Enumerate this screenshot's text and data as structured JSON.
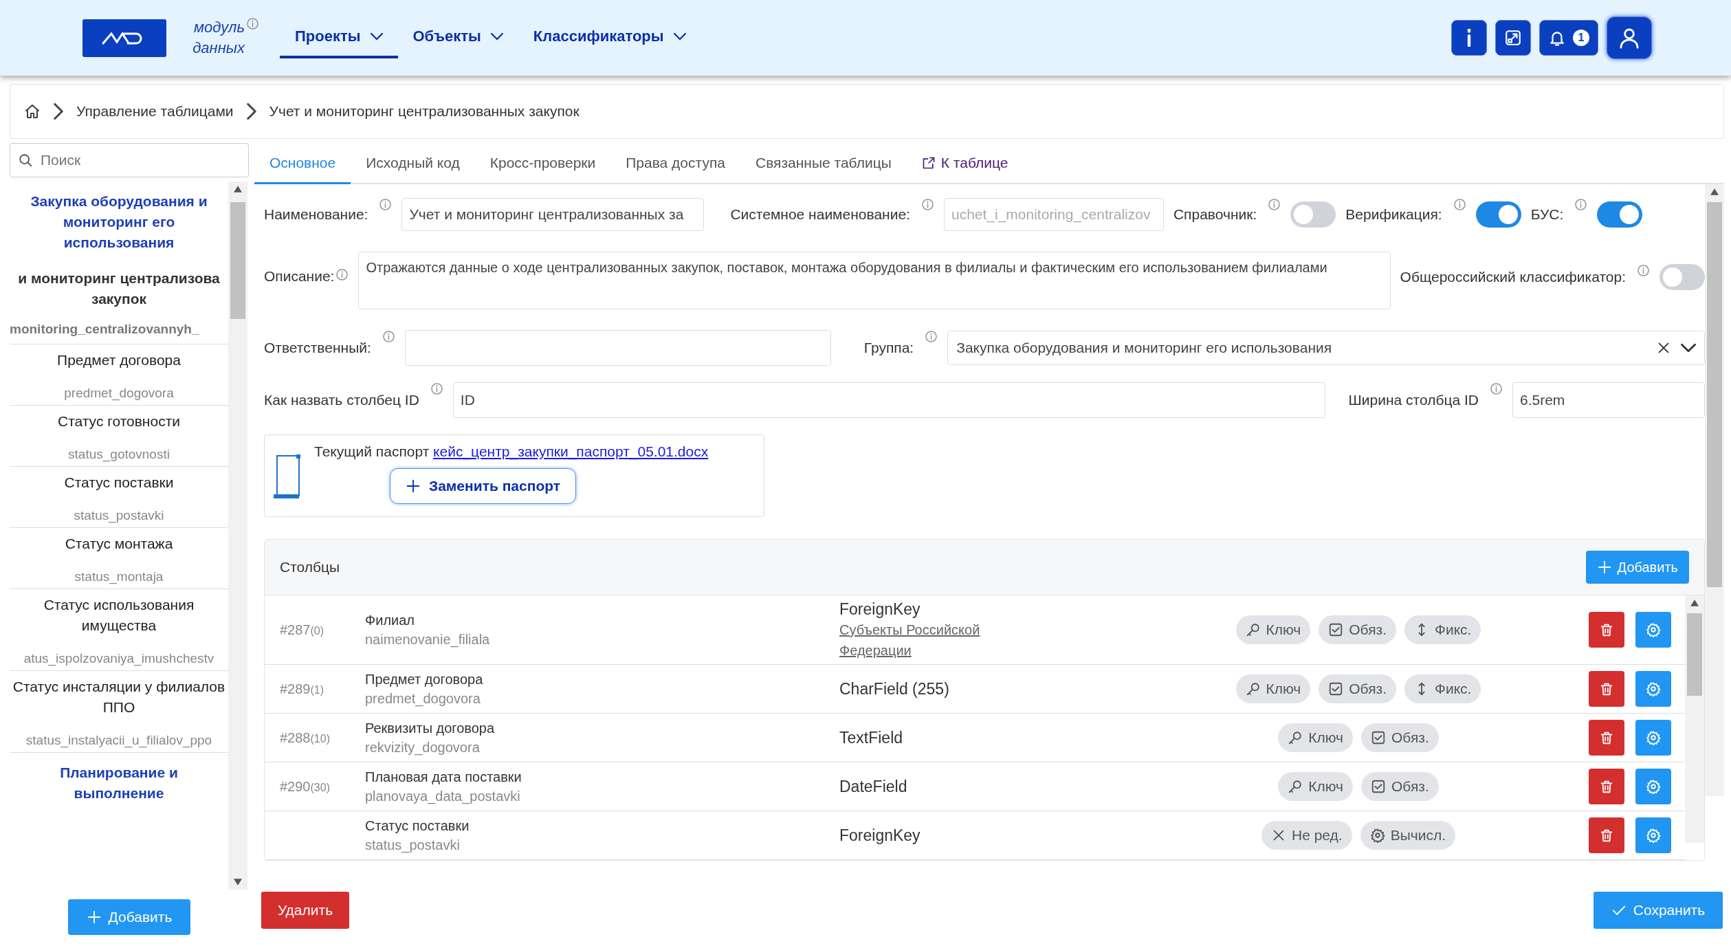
{
  "header": {
    "logo_caption": "модуль данных",
    "nav": [
      {
        "label": "Проекты",
        "selected": true
      },
      {
        "label": "Объекты",
        "selected": false
      },
      {
        "label": "Классификаторы",
        "selected": false
      }
    ],
    "notifications_count": "1"
  },
  "breadcrumb": [
    "Управление таблицами",
    "Учет и мониторинг централизованных закупок"
  ],
  "sidebar": {
    "search_placeholder": "Поиск",
    "group": "Закупка оборудования и мониторинг его использования",
    "table_title_lines": [
      "и мониторинг централизова",
      "закупок"
    ],
    "table_system_name": "monitoring_centralizovannyh_",
    "items": [
      {
        "name": "Предмет договора",
        "system_name": "predmet_dogovora"
      },
      {
        "name": "Статус готовности",
        "system_name": "status_gotovnosti"
      },
      {
        "name": "Статус поставки",
        "system_name": "status_postavki"
      },
      {
        "name": "Статус монтажа",
        "system_name": "status_montaja"
      },
      {
        "name": "Статус использования имущества",
        "system_name": "atus_ispolzovaniya_imushchestv"
      },
      {
        "name": "Статус инсталяции у филиалов ППО",
        "system_name": "status_instalyacii_u_filialov_ppo"
      }
    ],
    "next_group": "Планирование и выполнение",
    "add_button": "Добавить"
  },
  "tabs": [
    {
      "label": "Основное",
      "selected": true,
      "kind": "tab"
    },
    {
      "label": "Исходный код",
      "selected": false,
      "kind": "tab"
    },
    {
      "label": "Кросс-проверки",
      "selected": false,
      "kind": "tab"
    },
    {
      "label": "Права доступа",
      "selected": false,
      "kind": "tab"
    },
    {
      "label": "Связанные таблицы",
      "selected": false,
      "kind": "tab"
    },
    {
      "label": "К таблице",
      "kind": "link"
    }
  ],
  "form": {
    "name": {
      "label": "Наименование:",
      "value": "Учет и мониторинг централизованных за"
    },
    "system_name": {
      "label": "Системное наименование:",
      "value": "uchet_i_monitoring_centralizov",
      "disabled": true
    },
    "toggles": [
      {
        "label": "Справочник:",
        "on": false
      },
      {
        "label": "Верификация:",
        "on": true
      },
      {
        "label": "БУС:",
        "on": true
      }
    ],
    "description": {
      "label": "Описание:",
      "value": "Отражаются данные о ходе централизованных закупок, поставок, монтажа оборудования в филиалы и фактическим его использованием филиалами"
    },
    "classifier": {
      "label": "Общероссийский классификатор:",
      "on": false
    },
    "responsible": {
      "label": "Ответственный:"
    },
    "group": {
      "label": "Группа:",
      "value": "Закупка оборудования и мониторинг его использования"
    },
    "id_column_name": {
      "label": "Как назвать столбец ID",
      "value": "ID"
    },
    "id_column_width": {
      "label": "Ширина столбца ID",
      "value": "6.5rem"
    },
    "passport": {
      "label": "Текущий паспорт",
      "file": "кейс_центр_закупки_паспорт_05.01.docx",
      "button": "Заменить паспорт"
    }
  },
  "columns_panel": {
    "title": "Столбцы",
    "add_button": "Добавить",
    "rows": [
      {
        "id": "#287",
        "order": "(0)",
        "name": "Филиал",
        "system_name": "naimenovanie_filiala",
        "type": "ForeignKey",
        "reference": "Субъекты Российской Федерации",
        "chips": [
          {
            "kind": "key",
            "label": "Ключ"
          },
          {
            "kind": "required",
            "label": "Обяз."
          },
          {
            "kind": "fixed",
            "label": "Фикс."
          }
        ]
      },
      {
        "id": "#289",
        "order": "(1)",
        "name": "Предмет договора",
        "system_name": "predmet_dogovora",
        "type": "CharField (255)",
        "chips": [
          {
            "kind": "key",
            "label": "Ключ"
          },
          {
            "kind": "required",
            "label": "Обяз."
          },
          {
            "kind": "fixed",
            "label": "Фикс."
          }
        ]
      },
      {
        "id": "#288",
        "order": "(10)",
        "name": "Реквизиты договора",
        "system_name": "rekvizity_dogovora",
        "type": "TextField",
        "chips": [
          {
            "kind": "key",
            "label": "Ключ"
          },
          {
            "kind": "required",
            "label": "Обяз."
          }
        ]
      },
      {
        "id": "#290",
        "order": "(30)",
        "name": "Плановая дата поставки",
        "system_name": "planovaya_data_postavki",
        "type": "DateField",
        "chips": [
          {
            "kind": "key",
            "label": "Ключ"
          },
          {
            "kind": "required",
            "label": "Обяз."
          }
        ]
      },
      {
        "name": "Статус поставки",
        "system_name": "status_postavki",
        "type": "ForeignKey",
        "chips": [
          {
            "kind": "readonly",
            "label": "Не ред."
          },
          {
            "kind": "computed",
            "label": "Вычисл."
          }
        ]
      }
    ]
  },
  "actions": {
    "delete": "Удалить",
    "save": "Сохранить"
  }
}
